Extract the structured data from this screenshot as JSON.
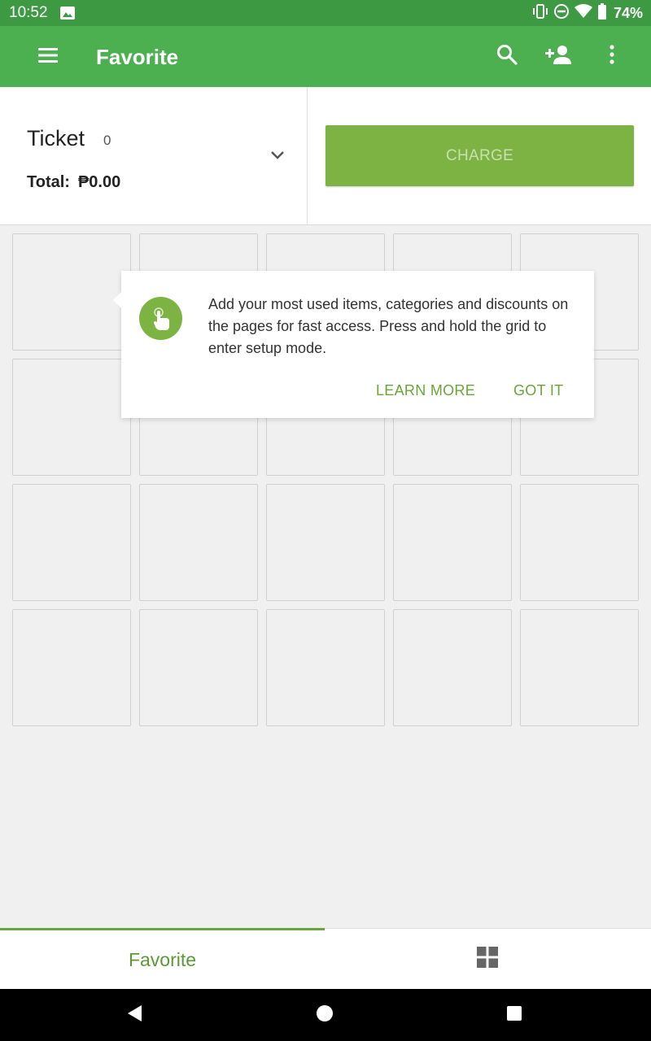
{
  "status_bar": {
    "time": "10:52",
    "battery": "74%",
    "icons": [
      "image-icon",
      "vibrate-icon",
      "do-not-disturb-icon",
      "wifi-icon",
      "battery-icon"
    ]
  },
  "app_bar": {
    "title": "Favorite",
    "icons": [
      "menu-icon",
      "search-icon",
      "add-person-icon",
      "more-vert-icon"
    ]
  },
  "ticket": {
    "title": "Ticket",
    "count": "0",
    "total_label": "Total:",
    "total_value": "₱0.00",
    "charge_label": "CHARGE"
  },
  "tooltip": {
    "text": "Add your most used items, categories and discounts on the pages for fast access. Press and hold the grid to enter setup mode.",
    "learn_more": "LEARN MORE",
    "got_it": "GOT IT",
    "icon": "touch-hand-icon"
  },
  "grid": {
    "rows": 4,
    "columns": 5
  },
  "tabs": {
    "favorite_label": "Favorite",
    "grid_icon": "grid-icon"
  },
  "colors": {
    "status_bar": "#3d9a43",
    "app_bar": "#4caf50",
    "accent": "#7cb342",
    "accent_text": "#6aa53a"
  }
}
